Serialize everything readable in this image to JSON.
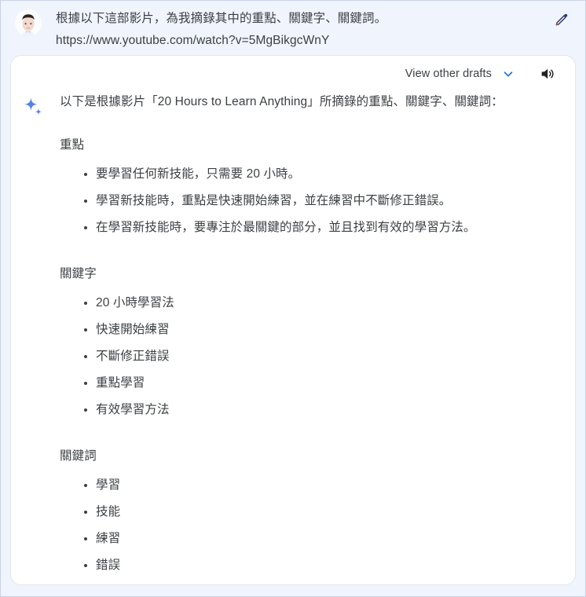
{
  "colors": {
    "page_background": "#f0f4fd",
    "card_background": "#ffffff",
    "text": "#3c4043",
    "accent_blue": "#1a73e8",
    "sparkle_orange": "#e8710a",
    "sparkle_blue": "#4285f4",
    "sparkle_purple": "#9b72cb"
  },
  "prompt": {
    "avatar_name": "user-avatar",
    "text": "根據以下這部影片，為我摘錄其中的重點、關鍵字、關鍵詞。",
    "url": "https://www.youtube.com/watch?v=5MgBikgcWnY",
    "edit_icon": "pencil-icon"
  },
  "response": {
    "drafts_label": "View other drafts",
    "chevron_icon": "chevron-down-icon",
    "speaker_icon": "volume-up-icon",
    "sparkle_icon": "gemini-sparkle-icon",
    "intro": "以下是根據影片「20 Hours to Learn Anything」所摘錄的重點、關鍵字、關鍵詞：",
    "sections": [
      {
        "heading": "重點",
        "items": [
          "要學習任何新技能，只需要 20 小時。",
          "學習新技能時，重點是快速開始練習，並在練習中不斷修正錯誤。",
          "在學習新技能時，要專注於最關鍵的部分，並且找到有效的學習方法。"
        ]
      },
      {
        "heading": "關鍵字",
        "items": [
          "20 小時學習法",
          "快速開始練習",
          "不斷修正錯誤",
          "重點學習",
          "有效學習方法"
        ]
      },
      {
        "heading": "關鍵詞",
        "items": [
          "學習",
          "技能",
          "練習",
          "錯誤"
        ]
      }
    ]
  }
}
